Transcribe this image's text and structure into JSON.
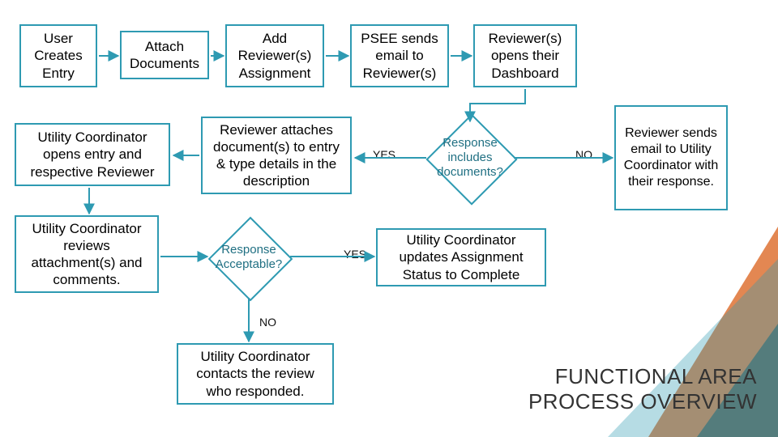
{
  "chart_data": {
    "type": "flowchart",
    "title": "FUNCTIONAL AREA PROCESS OVERVIEW",
    "nodes": [
      {
        "id": "n1",
        "kind": "process",
        "text": "User Creates Entry"
      },
      {
        "id": "n2",
        "kind": "process",
        "text": "Attach Documents"
      },
      {
        "id": "n3",
        "kind": "process",
        "text": "Add Reviewer(s) Assignment"
      },
      {
        "id": "n4",
        "kind": "process",
        "text": "PSEE sends email to Reviewer(s)"
      },
      {
        "id": "n5",
        "kind": "process",
        "text": "Reviewer(s) opens their Dashboard"
      },
      {
        "id": "d1",
        "kind": "decision",
        "text": "Response includes documents?"
      },
      {
        "id": "n6",
        "kind": "process",
        "text": "Reviewer sends email to Utility Coordinator with their response."
      },
      {
        "id": "n7",
        "kind": "process",
        "text": "Reviewer attaches document(s) to entry & type details in the description"
      },
      {
        "id": "n8",
        "kind": "process",
        "text": "Utility Coordinator opens entry and respective Reviewer"
      },
      {
        "id": "n9",
        "kind": "process",
        "text": "Utility Coordinator reviews attachment(s) and comments."
      },
      {
        "id": "d2",
        "kind": "decision",
        "text": "Response Acceptable?"
      },
      {
        "id": "n10",
        "kind": "process",
        "text": "Utility Coordinator updates Assignment Status to Complete"
      },
      {
        "id": "n11",
        "kind": "process",
        "text": "Utility Coordinator contacts the review who responded."
      }
    ],
    "edges": [
      {
        "from": "n1",
        "to": "n2"
      },
      {
        "from": "n2",
        "to": "n3"
      },
      {
        "from": "n3",
        "to": "n4"
      },
      {
        "from": "n4",
        "to": "n5"
      },
      {
        "from": "n5",
        "to": "d1"
      },
      {
        "from": "d1",
        "to": "n7",
        "label": "YES"
      },
      {
        "from": "d1",
        "to": "n6",
        "label": "NO"
      },
      {
        "from": "n6",
        "to": "n8"
      },
      {
        "from": "n7",
        "to": "n8"
      },
      {
        "from": "n8",
        "to": "n9"
      },
      {
        "from": "n9",
        "to": "d2"
      },
      {
        "from": "d2",
        "to": "n10",
        "label": "YES"
      },
      {
        "from": "d2",
        "to": "n11",
        "label": "NO"
      }
    ]
  },
  "labels": {
    "yes": "YES",
    "no": "NO"
  }
}
